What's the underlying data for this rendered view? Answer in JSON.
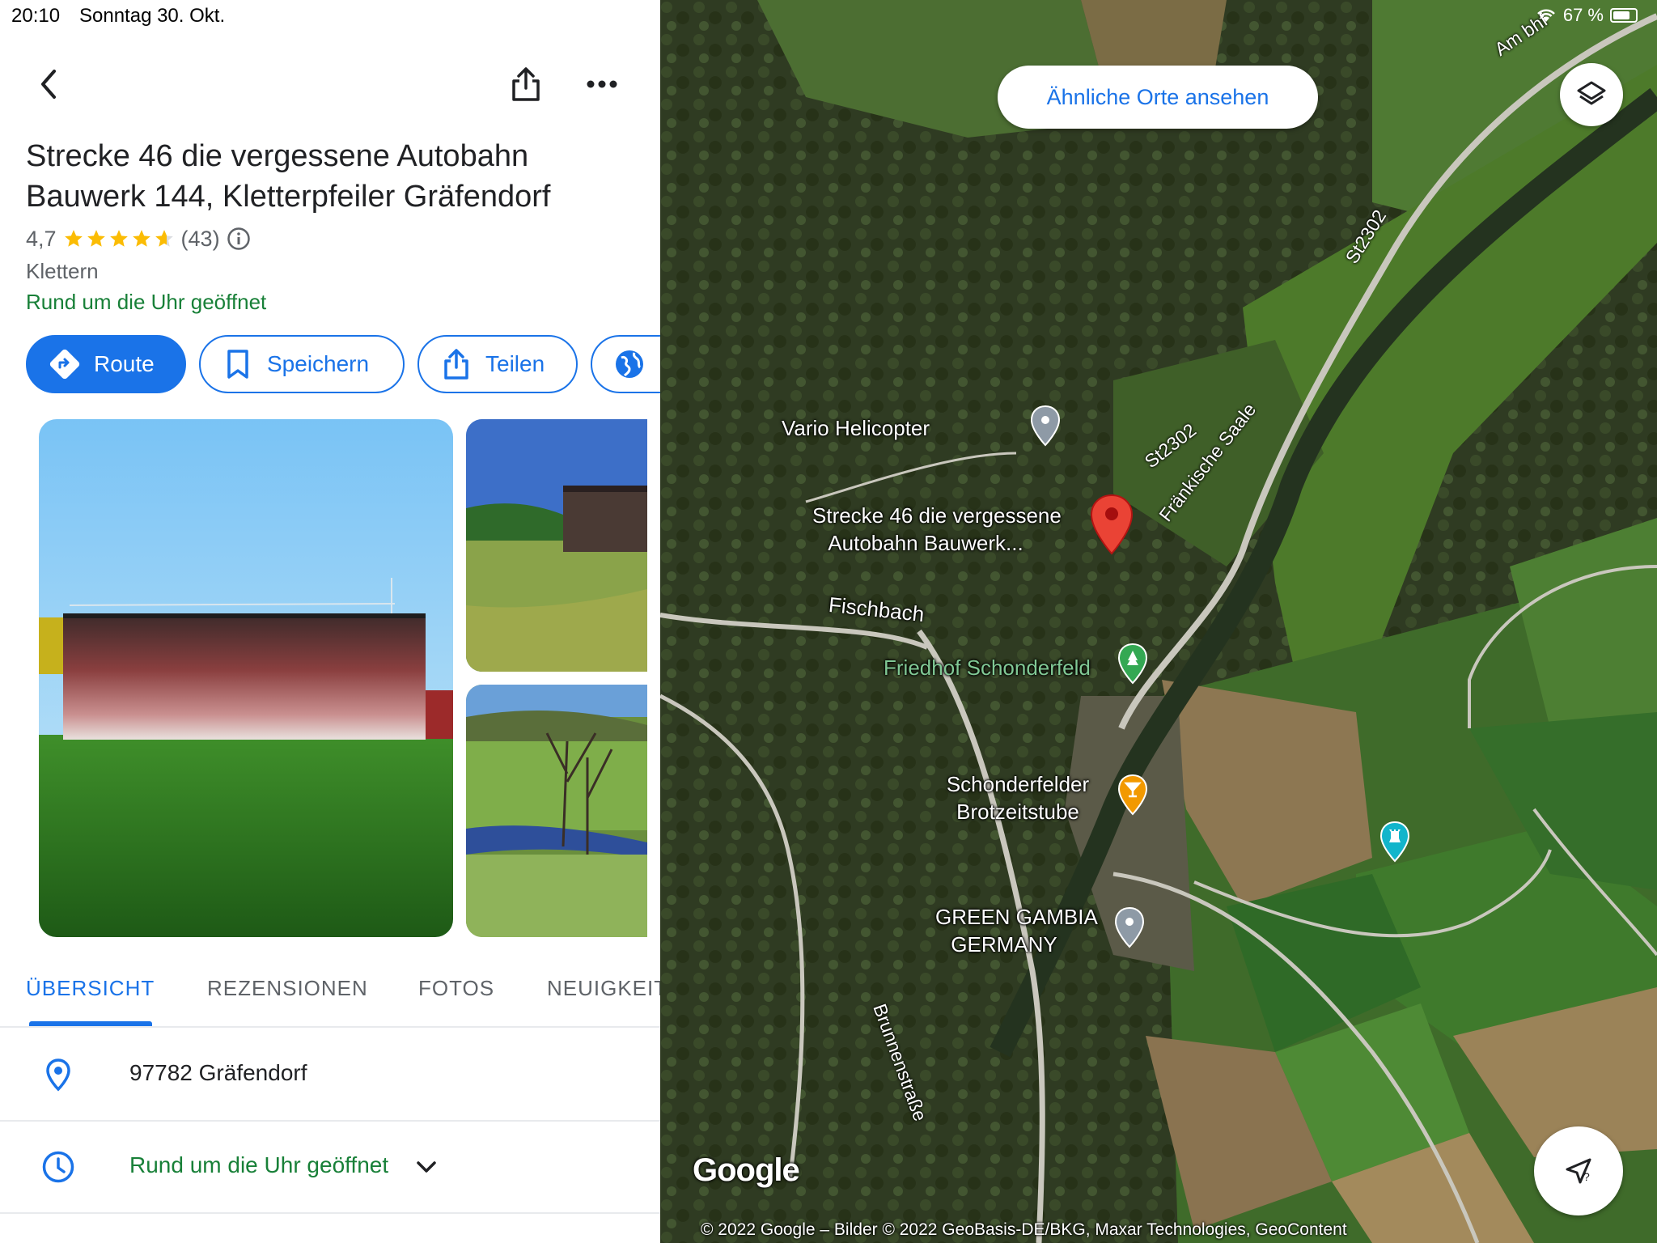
{
  "status_bar": {
    "time": "20:10",
    "date": "Sonntag 30. Okt.",
    "battery": "67 %"
  },
  "place": {
    "title_line1": "Strecke 46 die vergessene Autobahn",
    "title_line2": "Bauwerk 144, Kletterpfeiler Gräfendorf",
    "rating": "4,7",
    "rating_value": 4.7,
    "review_count": "(43)",
    "category": "Klettern",
    "hours_status": "Rund um die Uhr geöffnet"
  },
  "actions": {
    "route": "Route",
    "save": "Speichern",
    "share": "Teilen"
  },
  "tabs": {
    "overview": "ÜBERSICHT",
    "reviews": "REZENSIONEN",
    "photos": "FOTOS",
    "news": "NEUIGKEIT"
  },
  "info": {
    "address": "97782 Gräfendorf",
    "hours": "Rund um die Uhr geöffnet"
  },
  "map": {
    "similar_places_button": "Ähnliche Orte ansehen",
    "labels": {
      "vario": "Vario Helicopter",
      "strecke_line1": "Strecke 46 die vergessene",
      "strecke_line2": "Autobahn Bauwerk...",
      "fischbach": "Fischbach",
      "friedhof": "Friedhof Schonderfeld",
      "brotzeit_line1": "Schonderfelder",
      "brotzeit_line2": "Brotzeitstube",
      "gambia_line1": "GREEN GAMBIA",
      "gambia_line2": "GERMANY",
      "st2302_upper": "St2302",
      "st2302_lower": "St2302",
      "am_bhf": "Am bhf",
      "saale": "Fränkische Saale",
      "brunnen": "Brunnenstraße"
    },
    "google_logo": "Google",
    "copyright": "© 2022 Google – Bilder © 2022 GeoBasis-DE/BKG, Maxar Technologies, GeoContent"
  },
  "colors": {
    "accent": "#1a73e8",
    "open_green": "#188038",
    "star": "#fbbc04",
    "pin_red": "#ea4335"
  }
}
